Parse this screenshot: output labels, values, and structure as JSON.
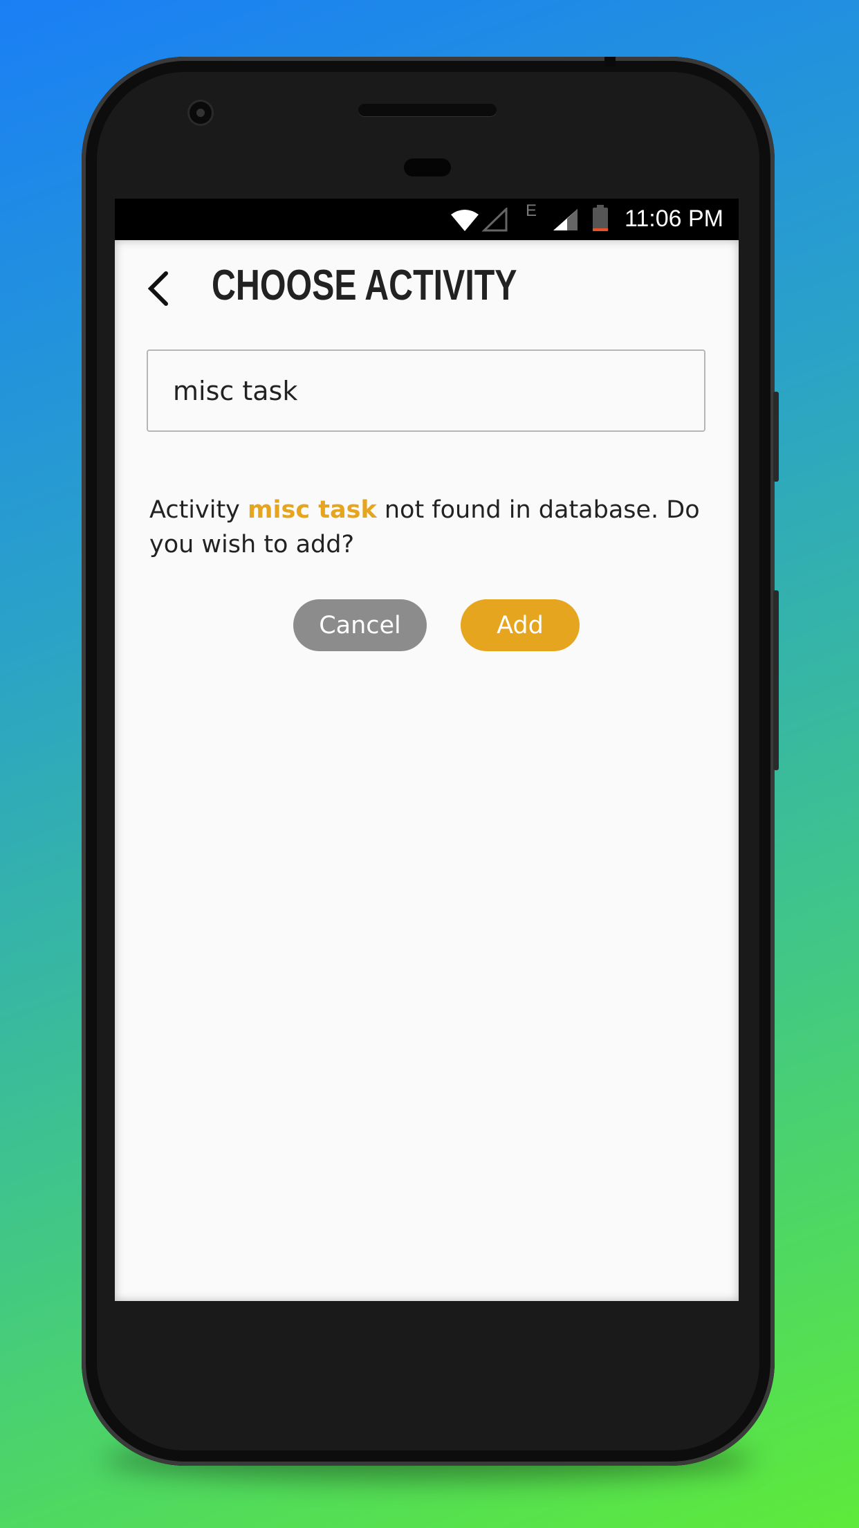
{
  "status_bar": {
    "time": "11:06 PM",
    "network_type": "E",
    "icons": [
      "wifi-icon",
      "no-signal-icon",
      "signal-icon",
      "battery-icon"
    ],
    "battery_low_color": "#e8542a"
  },
  "header": {
    "back_icon": "chevron-left-icon",
    "title": "CHOOSE ACTIVITY"
  },
  "search": {
    "value": "misc task"
  },
  "message": {
    "prefix": "Activity ",
    "activity": "misc task",
    "suffix": " not found in database. Do you wish to add?"
  },
  "actions": {
    "cancel_label": "Cancel",
    "add_label": "Add"
  },
  "colors": {
    "accent": "#e6a51e",
    "cancel": "#8c8c8c",
    "background": "#fafafa"
  }
}
